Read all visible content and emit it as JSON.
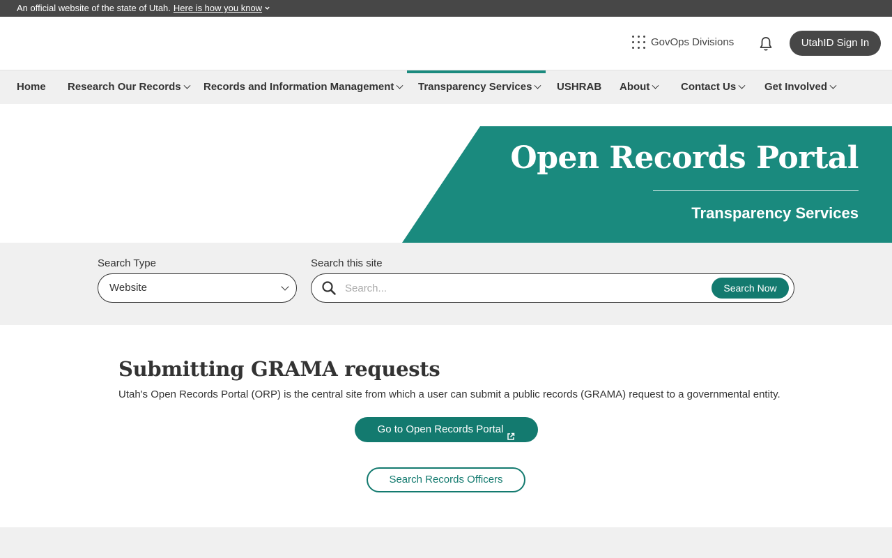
{
  "gov_banner": {
    "text": "An official website of the state of Utah.",
    "link": "Here is how you know"
  },
  "header": {
    "divisions_label": "GovOps Divisions",
    "signin_label": "UtahID Sign In"
  },
  "nav": {
    "items": [
      {
        "label": "Home"
      },
      {
        "label": "Research Our Records"
      },
      {
        "label": "Records and Information Management"
      },
      {
        "label": "Transparency Services"
      },
      {
        "label": "USHRAB"
      },
      {
        "label": "About"
      },
      {
        "label": "Contact Us"
      },
      {
        "label": "Get Involved"
      }
    ],
    "active": "Transparency Services"
  },
  "hero": {
    "title": "Open Records Portal",
    "subtitle": "Transparency Services"
  },
  "search": {
    "type_label": "Search Type",
    "type_value": "Website",
    "site_label": "Search this site",
    "placeholder": "Search...",
    "button": "Search Now"
  },
  "content": {
    "title": "Submitting GRAMA requests",
    "description": "Utah's Open Records Portal (ORP) is the central site from which a user can submit a public records (GRAMA) request to a governmental entity.",
    "primary_button": "Go to Open Records Portal",
    "secondary_button": "Search Records Officers"
  },
  "colors": {
    "accent": "#1a8a7e",
    "button": "#137a6f",
    "dark": "#474747"
  },
  "icons": [
    "grid-dots-icon",
    "bell-icon",
    "chevron-down-icon",
    "search-icon",
    "external-link-icon"
  ]
}
